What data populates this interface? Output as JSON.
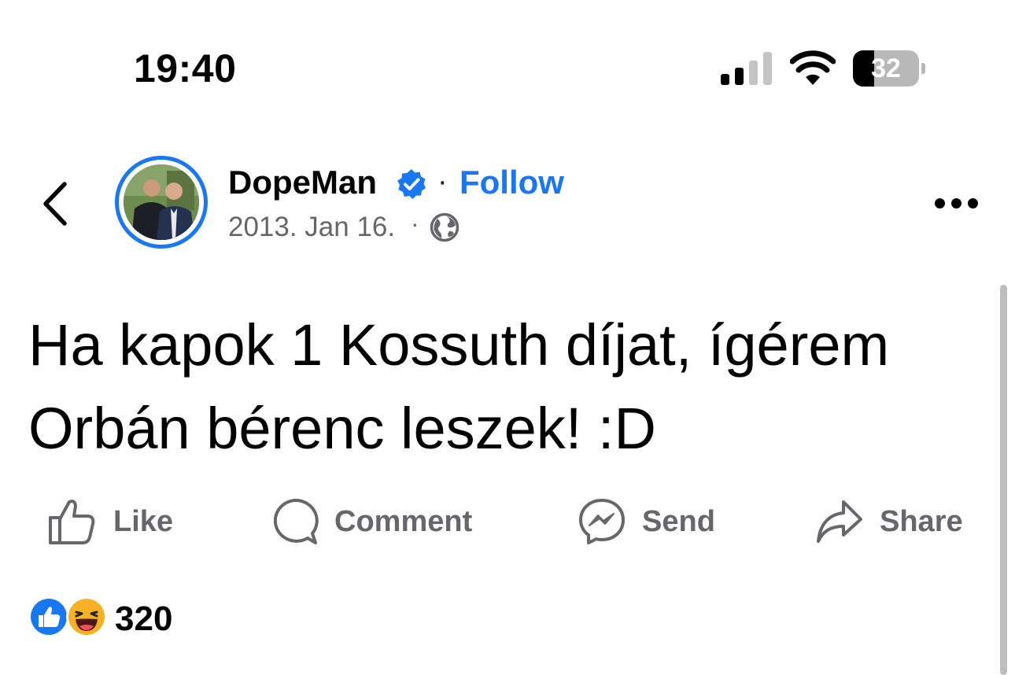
{
  "status_bar": {
    "time": "19:40",
    "battery_percent": "32",
    "battery_level": 0.32,
    "icons": [
      "cellular-signal-icon",
      "wifi-icon",
      "battery-icon"
    ]
  },
  "header": {
    "back_icon": "chevron-left-icon",
    "author": "DopeMan",
    "verified_icon": "verified-badge-icon",
    "separator": "·",
    "follow_label": "Follow",
    "timestamp": "2013. Jan 16.",
    "privacy_icon": "globe-icon",
    "more_icon": "more-horizontal-icon"
  },
  "post": {
    "text": "Ha kapok 1 Kossuth díjat, ígérem Orbán bérenc leszek! :D"
  },
  "actions": {
    "like": "Like",
    "comment": "Comment",
    "send": "Send",
    "share": "Share"
  },
  "reactions": {
    "types": [
      "like-reaction-icon",
      "haha-reaction-icon"
    ],
    "count": "320"
  },
  "colors": {
    "accent": "#1877f2",
    "secondary_text": "#65676b",
    "text": "#000000",
    "background": "#ffffff"
  }
}
